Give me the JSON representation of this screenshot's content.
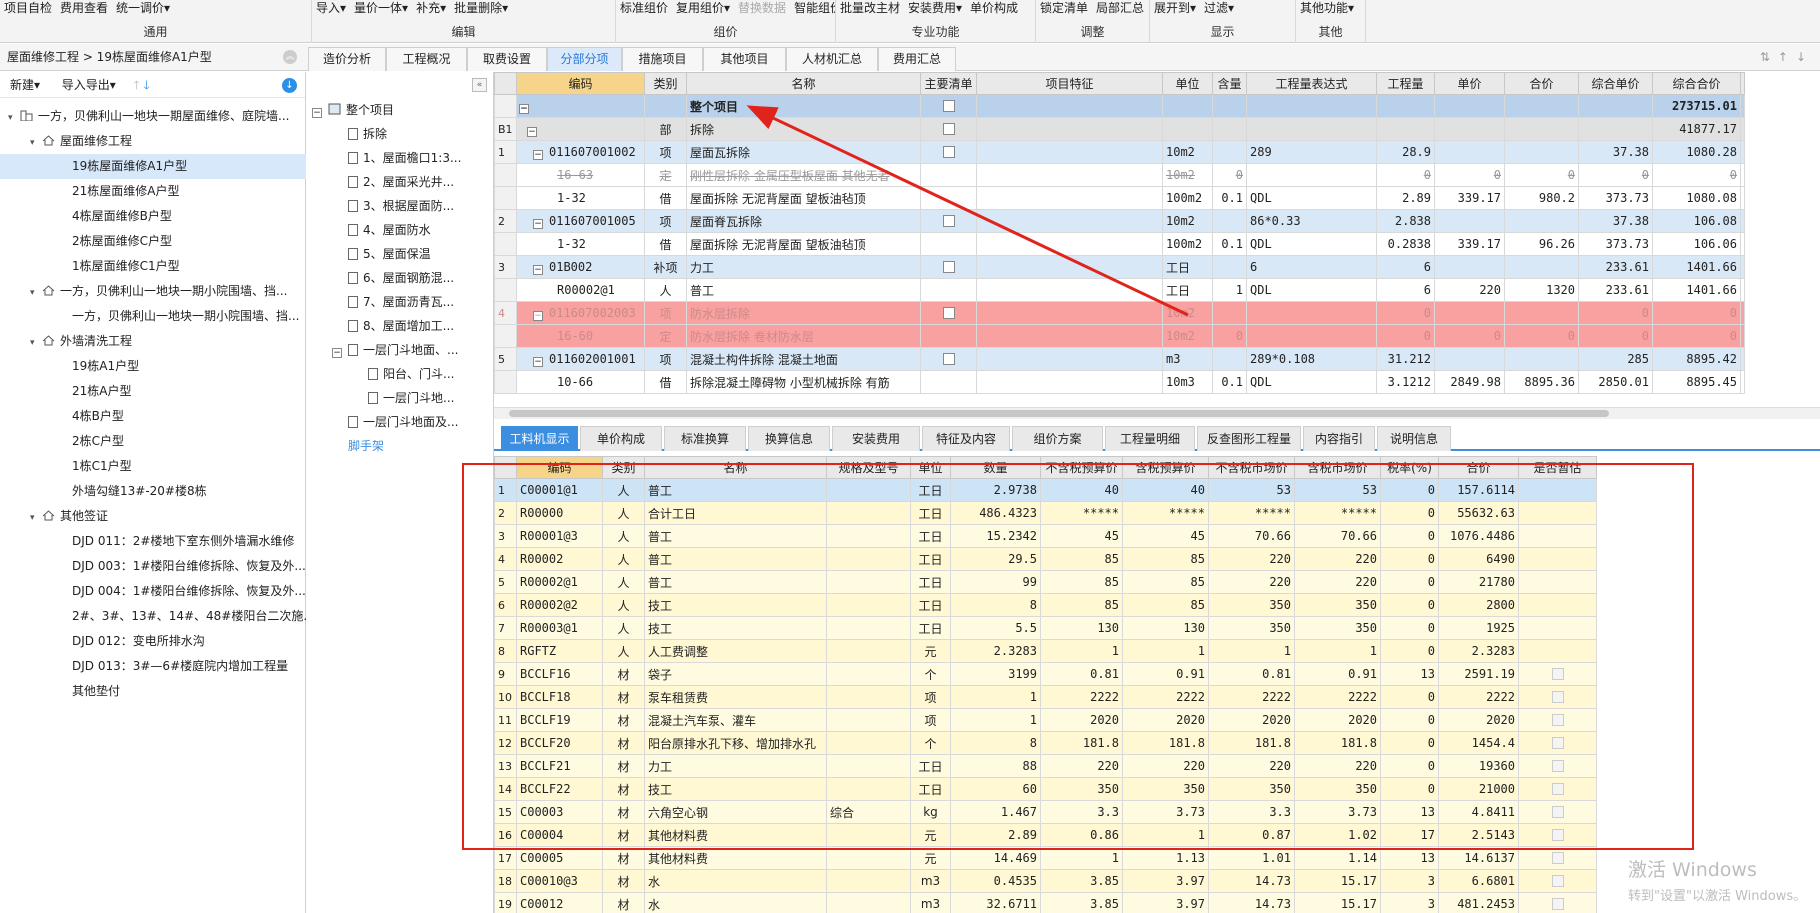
{
  "ribbon": {
    "groups": [
      {
        "label": "通用",
        "buttons": [
          "项目自检",
          "费用查看",
          "统一调价▾"
        ]
      },
      {
        "label": "编辑",
        "buttons": [
          "导入▾",
          "量价一体▾",
          "补充▾",
          "批量删除▾"
        ]
      },
      {
        "label": "组价",
        "buttons": [
          "标准组价",
          "复用组价▾",
          "替换数据",
          "智能组价▾"
        ],
        "disabled": [
          "替换数据"
        ]
      },
      {
        "label": "专业功能",
        "buttons": [
          "批量改主材",
          "安装费用▾",
          "单价构成"
        ]
      },
      {
        "label": "调整",
        "buttons": [
          "锁定清单",
          "局部汇总"
        ]
      },
      {
        "label": "显示",
        "buttons": [
          "展开到▾",
          "过滤▾"
        ]
      },
      {
        "label": "其他",
        "buttons": [
          "其他功能▾"
        ]
      }
    ]
  },
  "breadcrumb": "屋面维修工程 > 19栋屋面维修A1户型",
  "main_tabs": [
    "造价分析",
    "工程概况",
    "取费设置",
    "分部分项",
    "措施项目",
    "其他项目",
    "人材机汇总",
    "费用汇总"
  ],
  "active_main_tab": "分部分项",
  "left_toolbar": {
    "new": "新建▾",
    "import_export": "导入导出▾"
  },
  "project_tree": [
    {
      "label": "一方，贝佛利山一地块一期屋面维修、庭院墙...",
      "level": 0,
      "icon": "building-icon",
      "toggle": "▾"
    },
    {
      "label": "屋面维修工程",
      "level": 1,
      "icon": "house-icon",
      "toggle": "▾"
    },
    {
      "label": "19栋屋面维修A1户型",
      "level": 2,
      "selected": true
    },
    {
      "label": "21栋屋面维修A户型",
      "level": 2
    },
    {
      "label": "4栋屋面维修B户型",
      "level": 2
    },
    {
      "label": "2栋屋面维修C户型",
      "level": 2
    },
    {
      "label": "1栋屋面维修C1户型",
      "level": 2
    },
    {
      "label": "一方，贝佛利山一地块一期小院围墙、挡...",
      "level": 1,
      "icon": "house-icon",
      "toggle": "▾"
    },
    {
      "label": "一方，贝佛利山一地块一期小院围墙、挡...",
      "level": 2
    },
    {
      "label": "外墙清洗工程",
      "level": 1,
      "icon": "house-icon",
      "toggle": "▾"
    },
    {
      "label": "19栋A1户型",
      "level": 2
    },
    {
      "label": "21栋A户型",
      "level": 2
    },
    {
      "label": "4栋B户型",
      "level": 2
    },
    {
      "label": "2栋C户型",
      "level": 2
    },
    {
      "label": "1栋C1户型",
      "level": 2
    },
    {
      "label": "外墙勾缝13#-20#楼8栋",
      "level": 2
    },
    {
      "label": "其他签证",
      "level": 1,
      "icon": "house-icon",
      "toggle": "▾"
    },
    {
      "label": "DJD 011：2#楼地下室东侧外墙漏水维修",
      "level": 2
    },
    {
      "label": "DJD 003：1#楼阳台维修拆除、恢复及外...",
      "level": 2
    },
    {
      "label": "DJD 004：1#楼阳台维修拆除、恢复及外...",
      "level": 2
    },
    {
      "label": "2#、3#、13#、14#、48#楼阳台二次施...",
      "level": 2
    },
    {
      "label": "DJD 012：变电所排水沟",
      "level": 2
    },
    {
      "label": "DJD 013：3#—6#楼庭院内增加工程量",
      "level": 2
    },
    {
      "label": "其他垫付",
      "level": 2
    }
  ],
  "section_tree": [
    {
      "label": "整个项目",
      "level": 0,
      "toggle": "−",
      "icon": "project-icon"
    },
    {
      "label": "拆除",
      "level": 1
    },
    {
      "label": "1、屋面檐口1:3...",
      "level": 1
    },
    {
      "label": "2、屋面采光井...",
      "level": 1
    },
    {
      "label": "3、根据屋面防...",
      "level": 1
    },
    {
      "label": "4、屋面防水",
      "level": 1
    },
    {
      "label": "5、屋面保温",
      "level": 1
    },
    {
      "label": "6、屋面钢筋混...",
      "level": 1
    },
    {
      "label": "7、屋面沥青瓦...",
      "level": 1
    },
    {
      "label": "8、屋面增加工...",
      "level": 1
    },
    {
      "label": "一层门斗地面、...",
      "level": 1,
      "toggle": "−"
    },
    {
      "label": "阳台、门斗...",
      "level": 2
    },
    {
      "label": "一层门斗地...",
      "level": 2
    },
    {
      "label": "一层门斗地面及...",
      "level": 1
    },
    {
      "label": "脚手架",
      "level": 1,
      "link": true
    }
  ],
  "upper_grid": {
    "headers": [
      "编码",
      "类别",
      "名称",
      "主要清单",
      "项目特征",
      "单位",
      "含量",
      "工程量表达式",
      "工程量",
      "单价",
      "合价",
      "综合单价",
      "综合合价"
    ],
    "rows": [
      {
        "type": "proj",
        "rn": "",
        "code": "",
        "cat": "",
        "name": "整个项目",
        "main": true,
        "unit": "",
        "content": "",
        "expr": "",
        "qty": "",
        "price": "",
        "total": "",
        "cprice": "",
        "ctotal": "273715.01"
      },
      {
        "type": "div",
        "rn": "B1",
        "code": "",
        "cat": "部",
        "name": "拆除",
        "main": true,
        "unit": "",
        "content": "",
        "expr": "",
        "qty": "",
        "price": "",
        "total": "",
        "cprice": "",
        "ctotal": "41877.17"
      },
      {
        "type": "item",
        "rn": "1",
        "code": "011607001002",
        "cat": "项",
        "name": "屋面瓦拆除",
        "main": true,
        "unit": "10m2",
        "content": "",
        "expr": "289",
        "qty": "28.9",
        "price": "",
        "total": "",
        "cprice": "37.38",
        "ctotal": "1080.28"
      },
      {
        "type": "strike",
        "rn": "",
        "code": "16-63",
        "cat": "定",
        "name": "刚性层拆除 金属压型板屋面 其他无者",
        "main": false,
        "unit": "10m2",
        "content": "0",
        "expr": "",
        "qty": "0",
        "price": "0",
        "total": "0",
        "cprice": "0",
        "ctotal": "0"
      },
      {
        "type": "sub",
        "rn": "",
        "code": "1-32",
        "cat": "借",
        "name": "屋面拆除 无泥背屋面 望板油毡顶",
        "main": false,
        "unit": "100m2",
        "content": "0.1",
        "expr": "QDL",
        "qty": "2.89",
        "price": "339.17",
        "total": "980.2",
        "cprice": "373.73",
        "ctotal": "1080.08"
      },
      {
        "type": "item",
        "rn": "2",
        "code": "011607001005",
        "cat": "项",
        "name": "屋面脊瓦拆除",
        "main": true,
        "unit": "10m2",
        "content": "",
        "expr": "86*0.33",
        "qty": "2.838",
        "price": "",
        "total": "",
        "cprice": "37.38",
        "ctotal": "106.08"
      },
      {
        "type": "sub",
        "rn": "",
        "code": "1-32",
        "cat": "借",
        "name": "屋面拆除 无泥背屋面 望板油毡顶",
        "main": false,
        "unit": "100m2",
        "content": "0.1",
        "expr": "QDL",
        "qty": "0.2838",
        "price": "339.17",
        "total": "96.26",
        "cprice": "373.73",
        "ctotal": "106.06"
      },
      {
        "type": "item",
        "rn": "3",
        "code": "01B002",
        "cat": "补项",
        "name": "力工",
        "main": true,
        "unit": "工日",
        "content": "",
        "expr": "6",
        "qty": "6",
        "price": "",
        "total": "",
        "cprice": "233.61",
        "ctotal": "1401.66"
      },
      {
        "type": "sub",
        "rn": "",
        "code": "R00002@1",
        "cat": "人",
        "name": "普工",
        "main": false,
        "unit": "工日",
        "content": "1",
        "expr": "QDL",
        "qty": "6",
        "price": "220",
        "total": "1320",
        "cprice": "233.61",
        "ctotal": "1401.66"
      },
      {
        "type": "red",
        "rn": "4",
        "code": "011607002003",
        "cat": "项",
        "name": "防水层拆除",
        "main": true,
        "unit": "10m2",
        "content": "",
        "expr": "",
        "qty": "0",
        "price": "",
        "total": "",
        "cprice": "0",
        "ctotal": "0"
      },
      {
        "type": "red",
        "rn": "",
        "code": "16-60",
        "cat": "定",
        "name": "防水层拆除 卷材防水层",
        "main": false,
        "unit": "10m2",
        "content": "0",
        "expr": "",
        "qty": "0",
        "price": "0",
        "total": "0",
        "cprice": "0",
        "ctotal": "0"
      },
      {
        "type": "item",
        "rn": "5",
        "code": "011602001001",
        "cat": "项",
        "name": "混凝土构件拆除 混凝土地面",
        "main": true,
        "unit": "m3",
        "content": "",
        "expr": "289*0.108",
        "qty": "31.212",
        "price": "",
        "total": "",
        "cprice": "285",
        "ctotal": "8895.42"
      },
      {
        "type": "sub",
        "rn": "",
        "code": "10-66",
        "cat": "借",
        "name": "拆除混凝土障碍物 小型机械拆除 有筋",
        "main": false,
        "unit": "10m3",
        "content": "0.1",
        "expr": "QDL",
        "qty": "3.1212",
        "price": "2849.98",
        "total": "8895.36",
        "cprice": "2850.01",
        "ctotal": "8895.45"
      }
    ],
    "edge_chars": [
      "",
      "[]",
      "建",
      "建",
      "建",
      "建",
      "建",
      "建",
      "建",
      "建",
      "建",
      "建",
      "市"
    ]
  },
  "bottom_tabs": [
    "工料机显示",
    "单价构成",
    "标准换算",
    "换算信息",
    "安装费用",
    "特征及内容",
    "组价方案",
    "工程量明细",
    "反查图形工程量",
    "内容指引",
    "说明信息"
  ],
  "active_bottom_tab": "工料机显示",
  "lower_grid": {
    "headers": [
      "编码",
      "类别",
      "名称",
      "规格及型号",
      "单位",
      "数量",
      "不含税预算价",
      "含税预算价",
      "不含税市场价",
      "含税市场价",
      "税率(%)",
      "合价",
      "是否暂估"
    ],
    "rows": [
      {
        "rn": "1",
        "code": "C00001@1",
        "cat": "人",
        "name": "普工",
        "spec": "",
        "unit": "工日",
        "qty": "2.9738",
        "p1": "40",
        "p2": "40",
        "p3": "53",
        "p4": "53",
        "tax": "0",
        "total": "157.6114",
        "est": false
      },
      {
        "rn": "2",
        "code": "R00000",
        "cat": "人",
        "name": "合计工日",
        "spec": "",
        "unit": "工日",
        "qty": "486.4323",
        "p1": "*****",
        "p2": "*****",
        "p3": "*****",
        "p4": "*****",
        "tax": "0",
        "total": "55632.63",
        "est": false
      },
      {
        "rn": "3",
        "code": "R00001@3",
        "cat": "人",
        "name": "普工",
        "spec": "",
        "unit": "工日",
        "qty": "15.2342",
        "p1": "45",
        "p2": "45",
        "p3": "70.66",
        "p4": "70.66",
        "tax": "0",
        "total": "1076.4486",
        "est": false
      },
      {
        "rn": "4",
        "code": "R00002",
        "cat": "人",
        "name": "普工",
        "spec": "",
        "unit": "工日",
        "qty": "29.5",
        "p1": "85",
        "p2": "85",
        "p3": "220",
        "p4": "220",
        "tax": "0",
        "total": "6490",
        "est": false
      },
      {
        "rn": "5",
        "code": "R00002@1",
        "cat": "人",
        "name": "普工",
        "spec": "",
        "unit": "工日",
        "qty": "99",
        "p1": "85",
        "p2": "85",
        "p3": "220",
        "p4": "220",
        "tax": "0",
        "total": "21780",
        "est": false
      },
      {
        "rn": "6",
        "code": "R00002@2",
        "cat": "人",
        "name": "技工",
        "spec": "",
        "unit": "工日",
        "qty": "8",
        "p1": "85",
        "p2": "85",
        "p3": "350",
        "p4": "350",
        "tax": "0",
        "total": "2800",
        "est": false
      },
      {
        "rn": "7",
        "code": "R00003@1",
        "cat": "人",
        "name": "技工",
        "spec": "",
        "unit": "工日",
        "qty": "5.5",
        "p1": "130",
        "p2": "130",
        "p3": "350",
        "p4": "350",
        "tax": "0",
        "total": "1925",
        "est": false
      },
      {
        "rn": "8",
        "code": "RGFTZ",
        "cat": "人",
        "name": "人工费调整",
        "spec": "",
        "unit": "元",
        "qty": "2.3283",
        "p1": "1",
        "p2": "1",
        "p3": "1",
        "p4": "1",
        "tax": "0",
        "total": "2.3283",
        "est": false
      },
      {
        "rn": "9",
        "code": "BCCLF16",
        "cat": "材",
        "name": "袋子",
        "spec": "",
        "unit": "个",
        "qty": "3199",
        "p1": "0.81",
        "p2": "0.91",
        "p3": "0.81",
        "p4": "0.91",
        "tax": "13",
        "total": "2591.19",
        "est": true
      },
      {
        "rn": "10",
        "code": "BCCLF18",
        "cat": "材",
        "name": "泵车租赁费",
        "spec": "",
        "unit": "项",
        "qty": "1",
        "p1": "2222",
        "p2": "2222",
        "p3": "2222",
        "p4": "2222",
        "tax": "0",
        "total": "2222",
        "est": true
      },
      {
        "rn": "11",
        "code": "BCCLF19",
        "cat": "材",
        "name": "混凝土汽车泵、灌车",
        "spec": "",
        "unit": "项",
        "qty": "1",
        "p1": "2020",
        "p2": "2020",
        "p3": "2020",
        "p4": "2020",
        "tax": "0",
        "total": "2020",
        "est": true
      },
      {
        "rn": "12",
        "code": "BCCLF20",
        "cat": "材",
        "name": "阳台原排水孔下移、增加排水孔",
        "spec": "",
        "unit": "个",
        "qty": "8",
        "p1": "181.8",
        "p2": "181.8",
        "p3": "181.8",
        "p4": "181.8",
        "tax": "0",
        "total": "1454.4",
        "est": true
      },
      {
        "rn": "13",
        "code": "BCCLF21",
        "cat": "材",
        "name": "力工",
        "spec": "",
        "unit": "工日",
        "qty": "88",
        "p1": "220",
        "p2": "220",
        "p3": "220",
        "p4": "220",
        "tax": "0",
        "total": "19360",
        "est": true
      },
      {
        "rn": "14",
        "code": "BCCLF22",
        "cat": "材",
        "name": "技工",
        "spec": "",
        "unit": "工日",
        "qty": "60",
        "p1": "350",
        "p2": "350",
        "p3": "350",
        "p4": "350",
        "tax": "0",
        "total": "21000",
        "est": true
      },
      {
        "rn": "15",
        "code": "C00003",
        "cat": "材",
        "name": "六角空心钢",
        "spec": "综合",
        "unit": "kg",
        "qty": "1.467",
        "p1": "3.3",
        "p2": "3.73",
        "p3": "3.3",
        "p4": "3.73",
        "tax": "13",
        "total": "4.8411",
        "est": true
      },
      {
        "rn": "16",
        "code": "C00004",
        "cat": "材",
        "name": "其他材料费",
        "spec": "",
        "unit": "元",
        "qty": "2.89",
        "p1": "0.86",
        "p2": "1",
        "p3": "0.87",
        "p4": "1.02",
        "tax": "17",
        "total": "2.5143",
        "est": true
      },
      {
        "rn": "17",
        "code": "C00005",
        "cat": "材",
        "name": "其他材料费",
        "spec": "",
        "unit": "元",
        "qty": "14.469",
        "p1": "1",
        "p2": "1.13",
        "p3": "1.01",
        "p4": "1.14",
        "tax": "13",
        "total": "14.6137",
        "est": true
      },
      {
        "rn": "18",
        "code": "C00010@3",
        "cat": "材",
        "name": "水",
        "spec": "",
        "unit": "m3",
        "qty": "0.4535",
        "p1": "3.85",
        "p2": "3.97",
        "p3": "14.73",
        "p4": "15.17",
        "tax": "3",
        "total": "6.6801",
        "est": true
      },
      {
        "rn": "19",
        "code": "C00012",
        "cat": "材",
        "name": "水",
        "spec": "",
        "unit": "m3",
        "qty": "32.6711",
        "p1": "3.85",
        "p2": "3.97",
        "p3": "14.73",
        "p4": "15.17",
        "tax": "3",
        "total": "481.2453",
        "est": true
      }
    ]
  },
  "watermark": {
    "line1": "激活 Windows",
    "line2": "转到\"设置\"以激活 Windows。"
  },
  "colors": {
    "accent": "#3b8ee0",
    "annotation": "#e0241c",
    "highlight_row": "#f9a0a0",
    "header_highlight": "#f6d58b"
  }
}
